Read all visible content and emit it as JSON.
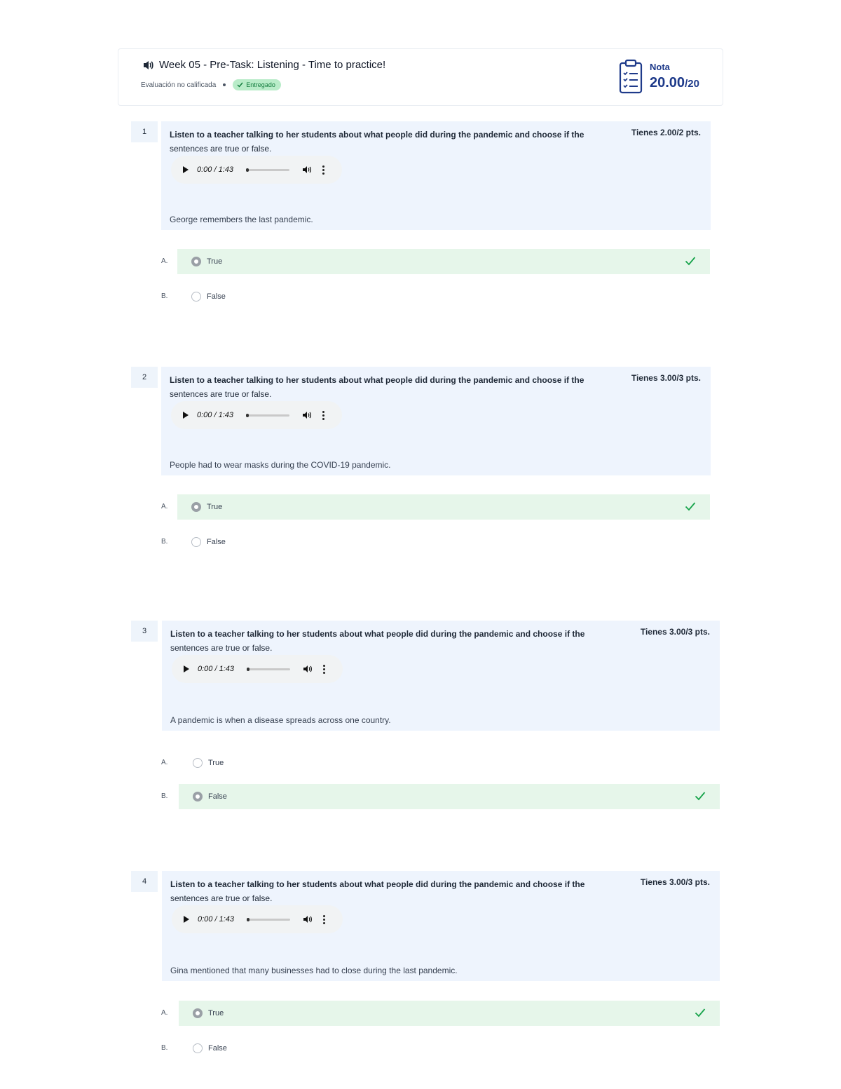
{
  "header": {
    "title": "Week 05 - Pre-Task: Listening - Time to practice!",
    "meta_label": "Evaluación no calificada",
    "status_badge": "Entregado",
    "grade_label": "Nota",
    "grade_value": "20.00",
    "grade_max": "/20"
  },
  "questions": [
    {
      "number": "1",
      "prompt_line1": "Listen to a teacher talking to her students about what people did during the pandemic and choose if the",
      "prompt_line2": "sentences are true or false.",
      "points": "Tienes 2.00/2 pts.",
      "audio_time": "0:00 / 1:43",
      "statement": "George remembers the last pandemic.",
      "options": [
        {
          "letter": "A.",
          "label": "True",
          "correct": true
        },
        {
          "letter": "B.",
          "label": "False",
          "correct": false
        }
      ]
    },
    {
      "number": "2",
      "prompt_line1": "Listen to a teacher talking to her students about what people did during the pandemic and choose if the",
      "prompt_line2": "sentences are true or false.",
      "points": "Tienes 3.00/3 pts.",
      "audio_time": "0:00 / 1:43",
      "statement": "People had to wear masks during the COVID-19 pandemic.",
      "options": [
        {
          "letter": "A.",
          "label": "True",
          "correct": true
        },
        {
          "letter": "B.",
          "label": "False",
          "correct": false
        }
      ]
    },
    {
      "number": "3",
      "prompt_line1": "Listen to a teacher talking to her students about what people did during the pandemic and choose if the",
      "prompt_line2": "sentences are true or false.",
      "points": "Tienes 3.00/3 pts.",
      "audio_time": "0:00 / 1:43",
      "statement": "A pandemic is when a disease spreads across one country.",
      "options": [
        {
          "letter": "A.",
          "label": "True",
          "correct": false
        },
        {
          "letter": "B.",
          "label": "False",
          "correct": true
        }
      ]
    },
    {
      "number": "4",
      "prompt_line1": "Listen to a teacher talking to her students about what people did during the pandemic and choose if the",
      "prompt_line2": "sentences are true or false.",
      "points": "Tienes 3.00/3 pts.",
      "audio_time": "0:00 / 1:43",
      "statement": "Gina mentioned that many businesses had to close during the last pandemic.",
      "options": [
        {
          "letter": "A.",
          "label": "True",
          "correct": true
        },
        {
          "letter": "B.",
          "label": "False",
          "correct": false
        }
      ]
    }
  ],
  "colors": {
    "accent": "#1e3a8a",
    "question_bg": "#eef4fd",
    "correct_bg": "#e6f6ea",
    "check": "#16a34a",
    "badge_bg": "#b9ecc9"
  }
}
